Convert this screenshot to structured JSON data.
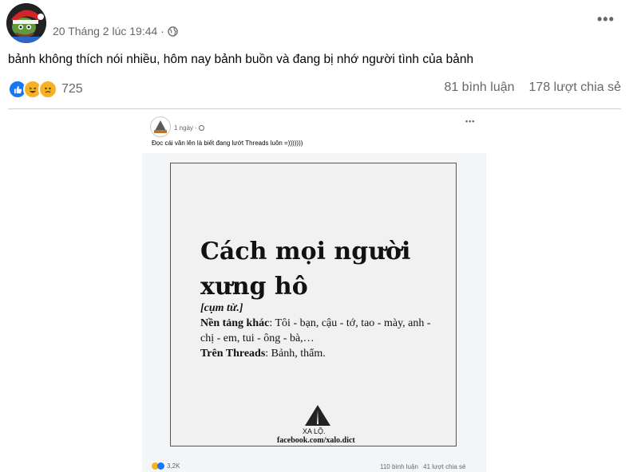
{
  "post": {
    "timestamp": "20 Tháng 2 lúc 19:44 ·",
    "text": "bảnh không thích nói nhiều, hôm nay bảnh buồn và đang bị nhớ người tình của bảnh",
    "reaction_count": "725",
    "comments": "81 bình luận",
    "shares": "178 lượt chia sẻ",
    "more": "•••"
  },
  "shared_post": {
    "time": "1 ngày ·",
    "text": "Đọc cái văn lên là biết đang lướt Threads luôn =)))))))",
    "more": "•••",
    "reaction_count": "3,2K",
    "comments": "110 bình luận",
    "shares": "41 lượt chia sẻ"
  },
  "dictionary": {
    "title_line1": "Cách mọi người",
    "title_line2": "xưng hô",
    "pos": "[cụm từ.]",
    "label_other": "Nền tảng khác",
    "other_text": ": Tôi - bạn, cậu - tớ, tao - mày, anh - chị - em, tui - ông - bà,…",
    "label_threads": "Trên Threads",
    "threads_text": ": Bảnh, thẩm.",
    "logo_text": "XA LỘ.",
    "source": "facebook.com/xalo.dict"
  },
  "colors": {
    "like_blue": "#1877f2",
    "haha_yellow": "#f7b125",
    "muted_text": "#65676b"
  },
  "icons": [
    "globe-icon",
    "like-icon",
    "haha-icon",
    "sad-icon",
    "more-icon",
    "road-logo-icon"
  ]
}
